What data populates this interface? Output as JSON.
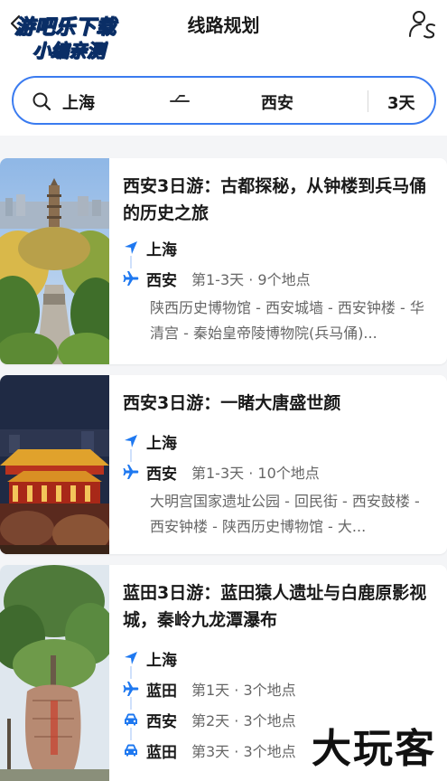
{
  "header": {
    "title": "线路规划",
    "watermark_line1": "游吧乐下载",
    "watermark_line2": "小编亲测"
  },
  "search": {
    "from": "上海",
    "to": "西安",
    "days": "3天"
  },
  "cards": [
    {
      "title": "西安3日游：古都探秘，从钟楼到兵马俑的历史之旅",
      "stops": [
        {
          "icon": "location-arrow-icon",
          "city": "上海",
          "meta": ""
        },
        {
          "icon": "plane-icon",
          "city": "西安",
          "meta": "第1-3天 · 9个地点"
        }
      ],
      "route": "陕西历史博物馆 - 西安城墙 - 西安钟楼 - 华清宫 - 秦始皇帝陵博物院(兵马俑)..."
    },
    {
      "title": "西安3日游：一睹大唐盛世颜",
      "stops": [
        {
          "icon": "location-arrow-icon",
          "city": "上海",
          "meta": ""
        },
        {
          "icon": "plane-icon",
          "city": "西安",
          "meta": "第1-3天 · 10个地点"
        }
      ],
      "route": "大明宫国家遗址公园 - 回民街 - 西安鼓楼 - 西安钟楼 - 陕西历史博物馆 - 大..."
    },
    {
      "title": "蓝田3日游：蓝田猿人遗址与白鹿原影视城，秦岭九龙潭瀑布",
      "stops": [
        {
          "icon": "location-arrow-icon",
          "city": "上海",
          "meta": ""
        },
        {
          "icon": "plane-icon",
          "city": "蓝田",
          "meta": "第1天 · 3个地点"
        },
        {
          "icon": "car-icon",
          "city": "西安",
          "meta": "第2天 · 3个地点"
        },
        {
          "icon": "car-icon",
          "city": "蓝田",
          "meta": "第3天 · 3个地点"
        }
      ],
      "route": ""
    }
  ],
  "brand_mark": "大玩客",
  "colors": {
    "accent": "#3a7bf0",
    "icon_blue": "#1e78f0",
    "text_dark": "#1a1a1a",
    "text_muted": "#666666"
  }
}
